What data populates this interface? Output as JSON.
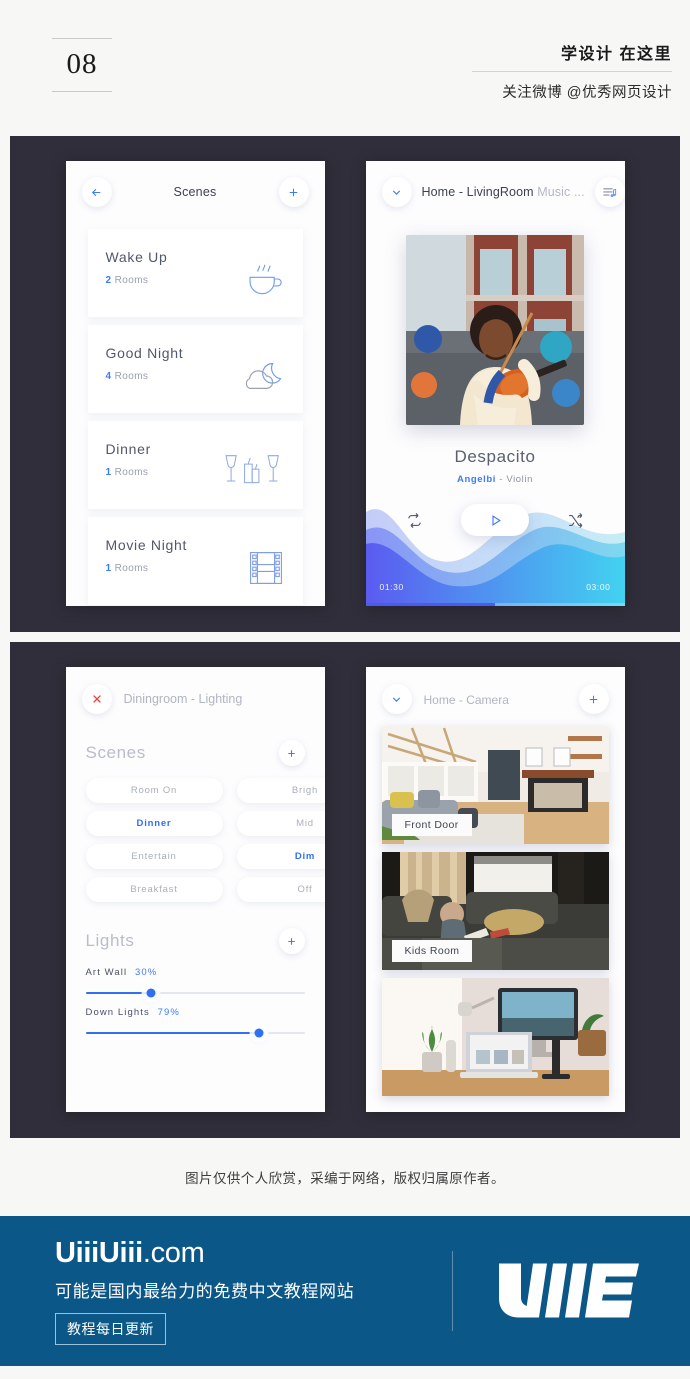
{
  "header": {
    "page_number": "08",
    "brand_title": "学设计 在这里",
    "brand_sub": "关注微博 @优秀网页设计"
  },
  "screen_scenes": {
    "back_icon": "arrow-left-icon",
    "title": "Scenes",
    "add_icon": "plus-icon",
    "cards": [
      {
        "name": "Wake Up",
        "count": "2",
        "unit": "Rooms",
        "icon": "coffee-cup-icon"
      },
      {
        "name": "Good Night",
        "count": "4",
        "unit": "Rooms",
        "icon": "moon-cloud-icon"
      },
      {
        "name": "Dinner",
        "count": "1",
        "unit": "Rooms",
        "icon": "wine-candle-icon"
      },
      {
        "name": "Movie Night",
        "count": "1",
        "unit": "Rooms",
        "icon": "film-strip-icon"
      }
    ]
  },
  "screen_music": {
    "collapse_icon": "chevron-down-icon",
    "title_main": "Home - LivingRoom",
    "title_dim": "Music ...",
    "queue_icon": "playlist-music-icon",
    "album_art": "street-violinist-photo",
    "track_name": "Despacito",
    "artist": "Angelbi",
    "artist_sep": " - ",
    "artist_instrument": "Violin",
    "repeat_icon": "repeat-icon",
    "play_icon": "play-icon",
    "shuffle_icon": "shuffle-icon",
    "time_elapsed": "01:30",
    "time_total": "03:00",
    "progress_percent": 50,
    "wave_color_left": "#5b5bf0",
    "wave_color_right": "#42d2f0"
  },
  "screen_lighting": {
    "close_icon": "close-x-icon",
    "room": "Diningroom",
    "room_sep": " - ",
    "room_mode": "Lighting",
    "scenes_title": "Scenes",
    "scenes_add_icon": "plus-icon",
    "chips_left": [
      "Room On",
      "Dinner",
      "Entertain",
      "Breakfast"
    ],
    "chips_right": [
      "Brigh",
      "Mid",
      "Dim",
      "Off"
    ],
    "active_left": "Dinner",
    "active_right": "Dim",
    "lights_title": "Lights",
    "lights_add_icon": "plus-icon",
    "sliders": [
      {
        "label": "Art Wall",
        "value": "30%",
        "pct": 30
      },
      {
        "label": "Down Lights",
        "value": "79%",
        "pct": 79
      }
    ],
    "accent": "#2f6ef5"
  },
  "screen_camera": {
    "collapse_icon": "chevron-down-icon",
    "title_main": "Home",
    "title_sep": " - ",
    "title_dim": "Camera",
    "add_icon": "plus-icon",
    "cameras": [
      {
        "label": "Front Door",
        "image": "living-room-fireplace-photo"
      },
      {
        "label": "Kids Room",
        "image": "child-reading-on-sofa-photo"
      },
      {
        "label": "",
        "image": "desk-with-laptop-monitor-photo"
      }
    ]
  },
  "caption": "图片仅供个人欣赏，采编于网络，版权归属原作者。",
  "footer": {
    "logo_bold": "UiiiUiii",
    "logo_light": ".com",
    "subtitle": "可能是国内最给力的免费中文教程网站",
    "badge": "教程每日更新",
    "mark_icon": "uiii-logo-mark",
    "bg": "#0b5788"
  }
}
